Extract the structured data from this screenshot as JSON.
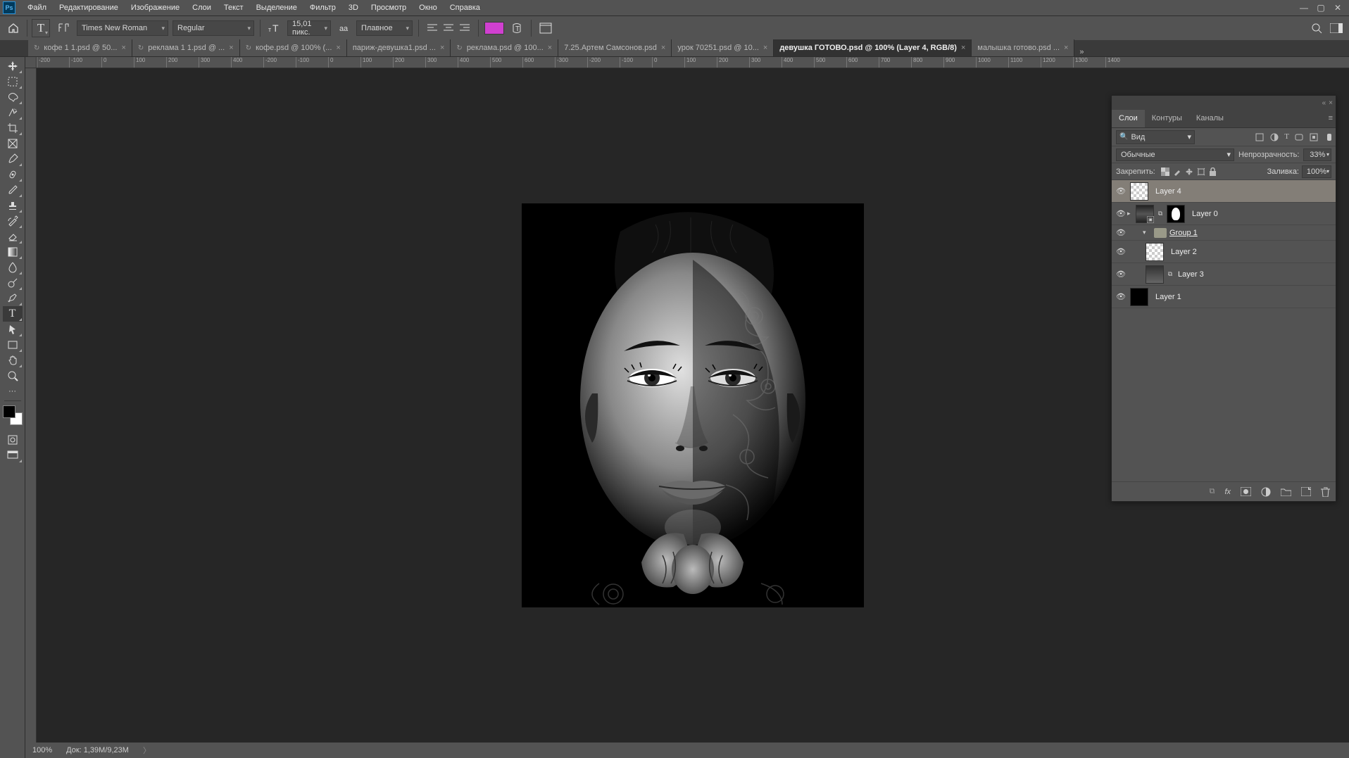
{
  "menu": {
    "items": [
      "Файл",
      "Редактирование",
      "Изображение",
      "Слои",
      "Текст",
      "Выделение",
      "Фильтр",
      "3D",
      "Просмотр",
      "Окно",
      "Справка"
    ]
  },
  "options": {
    "font_family": "Times New Roman",
    "font_style": "Regular",
    "font_size": "15,01 пикс.",
    "antialiasing": "Плавное",
    "color": "#d040d0"
  },
  "tabs": [
    {
      "label": "кофе 1 1.psd @ 50...",
      "sync": true,
      "active": false
    },
    {
      "label": "реклама 1 1.psd @ ...",
      "sync": true,
      "active": false
    },
    {
      "label": "кофе.psd @ 100% (...",
      "sync": true,
      "active": false
    },
    {
      "label": "париж-девушка1.psd ...",
      "sync": false,
      "active": false
    },
    {
      "label": "реклама.psd @ 100...",
      "sync": true,
      "active": false
    },
    {
      "label": "7.25.Артем Самсонов.psd",
      "sync": false,
      "active": false
    },
    {
      "label": "урок 70251.psd @ 10...",
      "sync": false,
      "active": false
    },
    {
      "label": "девушка ГОТОВО.psd @ 100% (Layer 4, RGB/8)",
      "sync": false,
      "active": true
    },
    {
      "label": "малышка готово.psd ...",
      "sync": false,
      "active": false
    }
  ],
  "ruler_h": [
    "-200",
    "-100",
    "0",
    "100",
    "200",
    "300",
    "400",
    "-200",
    "-100",
    "0",
    "100",
    "200",
    "300",
    "400",
    "500",
    "600",
    "-300",
    "-200",
    "-100",
    "0",
    "100",
    "200",
    "300",
    "400",
    "500",
    "600",
    "700",
    "800",
    "900",
    "1000",
    "1100",
    "1200",
    "1300",
    "1400"
  ],
  "status": {
    "zoom": "100%",
    "doc": "Док: 1,39M/9,23M"
  },
  "panel": {
    "tabs": [
      "Слои",
      "Контуры",
      "Каналы"
    ],
    "filter_label": "Вид",
    "blend_mode": "Обычные",
    "opacity_label": "Непрозрачность:",
    "opacity_value": "33%",
    "lock_label": "Закрепить:",
    "fill_label": "Заливка:",
    "fill_value": "100%"
  },
  "layers": [
    {
      "type": "layer",
      "name": "Layer 4",
      "selected": true,
      "thumb": "checker"
    },
    {
      "type": "smart",
      "name": "Layer 0",
      "thumb": "face",
      "mask": true,
      "fx": true
    },
    {
      "type": "group",
      "name": "Group 1",
      "open": true
    },
    {
      "type": "layer",
      "name": "Layer 2",
      "thumb": "checker",
      "indent": 1
    },
    {
      "type": "layer",
      "name": "Layer 3",
      "thumb": "checker",
      "mask_thumb": true,
      "indent": 1
    },
    {
      "type": "layer",
      "name": "Layer 1",
      "thumb": "black"
    }
  ]
}
